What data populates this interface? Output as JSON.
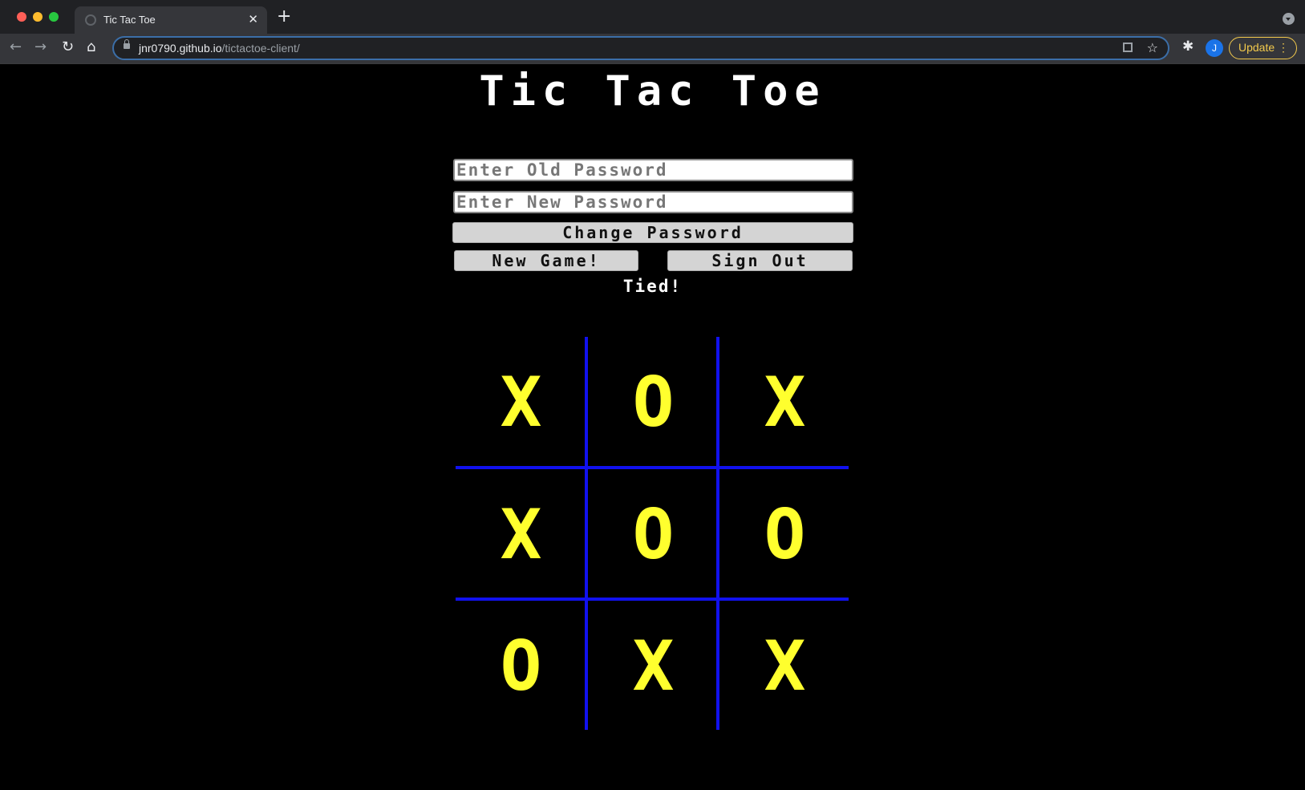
{
  "browser": {
    "tab_title": "Tic Tac Toe",
    "url_host": "jnr0790.github.io",
    "url_path": "/tictactoe-client/",
    "avatar_letter": "J",
    "update_label": "Update"
  },
  "page": {
    "title": "Tic Tac Toe",
    "old_password_placeholder": "Enter Old Password",
    "new_password_placeholder": "Enter New Password",
    "change_password_label": "Change Password",
    "new_game_label": "New Game!",
    "sign_out_label": "Sign Out",
    "status": "Tied!"
  },
  "board": {
    "cells": [
      "X",
      "O",
      "X",
      "X",
      "O",
      "O",
      "O",
      "X",
      "X"
    ],
    "mark_color": "#ffff2e",
    "line_color": "#1111ee"
  }
}
